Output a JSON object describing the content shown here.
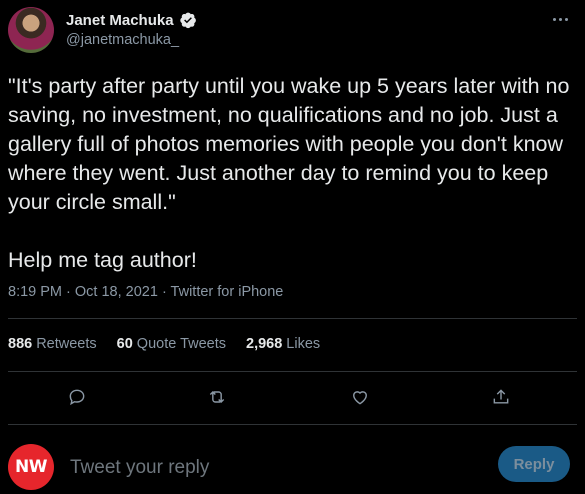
{
  "author": {
    "name": "Janet Machuka",
    "handle": "@janetmachuka_",
    "verified": true,
    "avatar": "profile-photo"
  },
  "tweet": {
    "text": "\"It's party after party until you wake up 5 years later with no saving, no investment, no qualifications and no job. Just a gallery full of photos memories with people you don't know where they went. Just another day to remind you to keep your circle small.\"\n\nHelp me tag author!",
    "time": "8:19 PM · Oct 18, 2021 · ",
    "source": "Twitter for iPhone"
  },
  "stats": {
    "retweets_count": "886",
    "retweets_label": "Retweets",
    "quotes_count": "60",
    "quotes_label": "Quote Tweets",
    "likes_count": "2,968",
    "likes_label": "Likes"
  },
  "actions": [
    "reply-icon",
    "retweet-icon",
    "like-icon",
    "share-icon"
  ],
  "reply": {
    "badge": "NW",
    "placeholder": "Tweet your reply",
    "button_label": "Reply"
  },
  "colors": {
    "background": "#000000",
    "text": "#e7e9ea",
    "secondary": "#8b98a5",
    "reply_button": "#1a5a86",
    "badge": "#e6262c"
  }
}
